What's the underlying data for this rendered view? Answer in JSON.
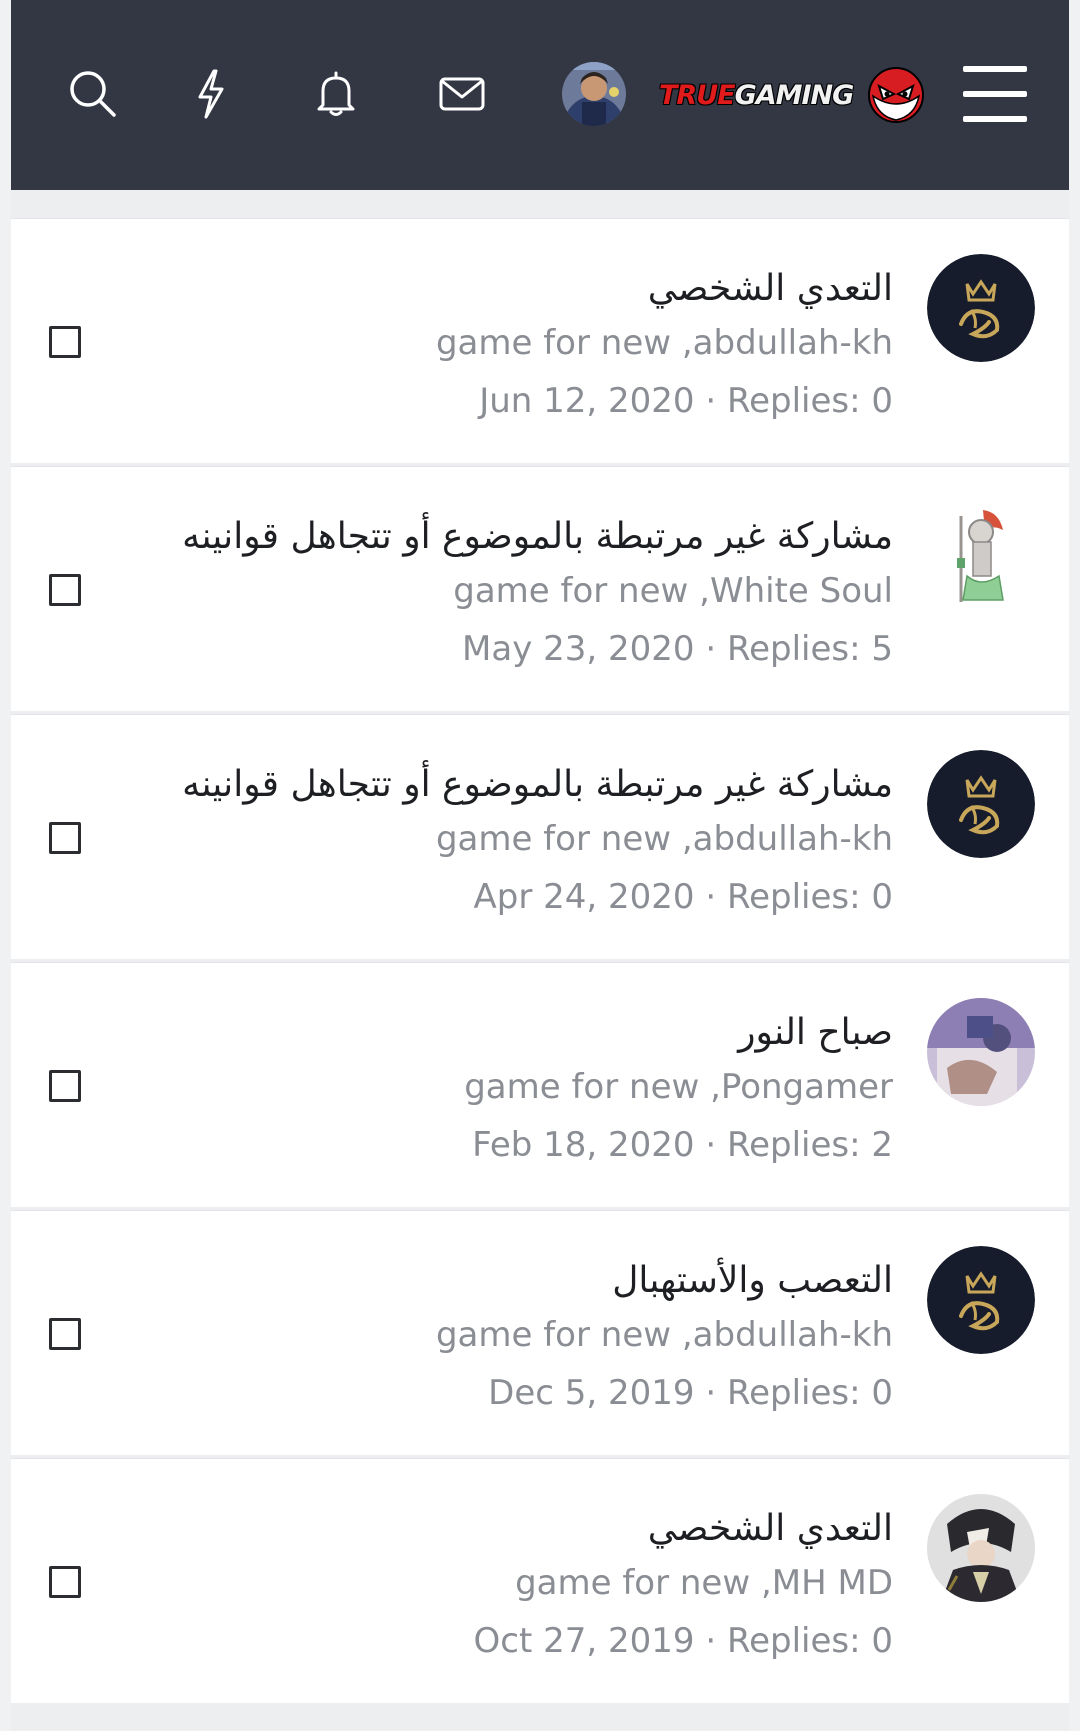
{
  "header": {
    "icons": [
      "search-icon",
      "lightning-icon",
      "bell-icon",
      "mail-icon"
    ],
    "logo_text_red": "TRUE",
    "logo_text_white": "GAMING",
    "menu_icon": "hamburger-menu-icon"
  },
  "threads": [
    {
      "title": "التعدي الشخصي",
      "starter": "game for new ,abdullah-kh",
      "date": "Jun 12, 2020",
      "replies": "Replies: 0",
      "separator": "·",
      "avatar": "calligraphy-avatar"
    },
    {
      "title": "مشاركة غير مرتبطة بالموضوع أو تتجاهل قوانينه",
      "starter": "game for new ,White Soul",
      "date": "May 23, 2020",
      "replies": "Replies: 5",
      "separator": "·",
      "avatar": "knight-avatar"
    },
    {
      "title": "مشاركة غير مرتبطة بالموضوع أو تتجاهل قوانينه",
      "starter": "game for new ,abdullah-kh",
      "date": "Apr 24, 2020",
      "replies": "Replies: 0",
      "separator": "·",
      "avatar": "calligraphy-avatar"
    },
    {
      "title": "صباح النور",
      "starter": "game for new ,Pongamer",
      "date": "Feb 18, 2020",
      "replies": "Replies: 2",
      "separator": "·",
      "avatar": "photo-avatar"
    },
    {
      "title": "التعصب والأستهبال",
      "starter": "game for new ,abdullah-kh",
      "date": "Dec 5, 2019",
      "replies": "Replies: 0",
      "separator": "·",
      "avatar": "calligraphy-avatar"
    },
    {
      "title": "التعدي الشخصي",
      "starter": "game for new ,MH MD",
      "date": "Oct 27, 2019",
      "replies": "Replies: 0",
      "separator": "·",
      "avatar": "anime-avatar"
    }
  ],
  "colors": {
    "header_bg": "#323743",
    "title_text": "#1d1f23",
    "meta_text": "#8a8d93",
    "logo_red": "#e11b1b"
  }
}
